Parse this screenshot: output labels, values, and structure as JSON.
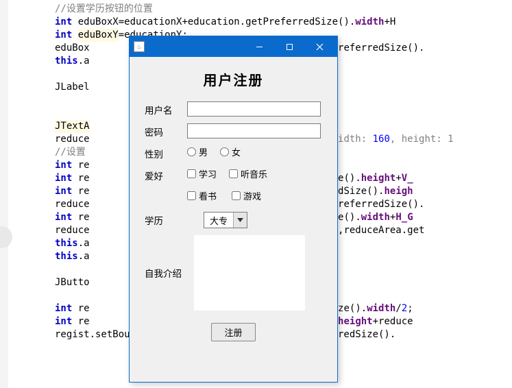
{
  "code": {
    "c1": "//设置学历按钮的位置",
    "l1a": "int",
    "l1b": " eduBoxX=educationX+education.getPreferredSize().",
    "l1c": "width",
    "l1d": "+H",
    "l2a": "int",
    "l2b": " ",
    "l2c": "eduBoxY",
    "l2d": "=educationY;",
    "l3a": "eduBox",
    "l3b": "referredSize().",
    "l4a": "this",
    "l4b": ".a",
    "l5": "JLabel",
    "l6": "JTextA",
    "l7a": "reduce",
    "l7b": "idth: ",
    "l7c": "160",
    "l7d": ", height: 1",
    "c2": "//设置",
    "l8a": "int",
    "l8b": " re",
    "l9a": "int",
    "l9b": " re",
    "l9c": "ize().",
    "l9d": "height",
    "l9e": "+",
    "l9f": "V_",
    "l10a": "int",
    "l10b": " re",
    "l10c": "redSize().",
    "l10d": "heigh",
    "l11a": "reduce",
    "l11b": "referredSize().",
    "l12a": "int",
    "l12b": " re",
    "l12c": "ize().",
    "l12d": "width",
    "l12e": "+",
    "l12f": "H_G",
    "l13a": "reduce",
    "l13b": ",reduceArea.get",
    "l14a": "this",
    "l14b": ".a",
    "l15a": "this",
    "l15b": ".a",
    "l16": "JButto",
    "l17a": "int",
    "l17b": " re",
    "l17c": "Size().",
    "l17d": "width",
    "l17e": "/",
    "l17f": "2",
    "l17g": ";",
    "l18a": "int",
    "l18b": " re",
    "l18c": ").",
    "l18d": "height",
    "l18e": "+reduce",
    "l19": "regist.setBounds(registX,registY,regist.getPreferredSize()."
  },
  "dialog": {
    "title": "用户注册",
    "labels": {
      "username": "用户名",
      "password": "密码",
      "gender": "性别",
      "hobby": "爱好",
      "education": "学历",
      "intro": "自我介绍"
    },
    "gender_options": {
      "male": "男",
      "female": "女"
    },
    "hobby_options": {
      "study": "学习",
      "music": "听音乐",
      "read": "看书",
      "game": "游戏"
    },
    "education_selected": "大专",
    "submit": "注册",
    "values": {
      "username": "",
      "password": "",
      "intro": ""
    }
  }
}
